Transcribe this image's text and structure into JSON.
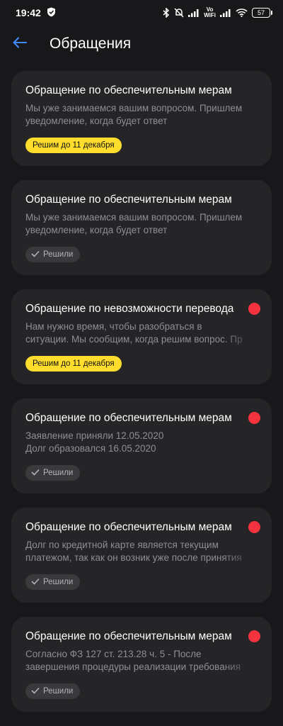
{
  "status_bar": {
    "time": "19:42",
    "vo": "Vo",
    "wifi_label": "WiFi",
    "battery": "57"
  },
  "header": {
    "title": "Обращения",
    "back_icon": "arrow-left-icon",
    "accent_color": "#3f8cff"
  },
  "cards": [
    {
      "title": "Обращение по обеспечительным мерам",
      "lines": [
        "Мы уже занимаемся вашим вопросом. Пришлем",
        "уведомление, когда будет ответ"
      ],
      "badge": "Решим до 11 декабря",
      "unread": false
    },
    {
      "title": "Обращение по обеспечительным мерам",
      "lines": [
        "Мы уже занимаемся вашим вопросом. Пришлем",
        "уведомление, когда будет ответ"
      ],
      "badge": "Решили",
      "unread": false
    },
    {
      "title": "Обращение по невозможности перевода",
      "lines": [
        "Нам нужно время, чтобы разобраться в",
        "ситуации. Мы сообщим, когда решим вопрос. Пр"
      ],
      "badge": "Решим до 11 декабря",
      "unread": true
    },
    {
      "title": "Обращение по обеспечительным мерам",
      "lines": [
        "Заявление приняли 12.05.2020",
        "Долг образовался 16.05.2020"
      ],
      "badge": "Решили",
      "unread": true
    },
    {
      "title": "Обращение по обеспечительным мерам",
      "lines": [
        "Долг по кредитной карте является текущим",
        "платежом, так как он возник уже после принятия"
      ],
      "badge": "Решили",
      "unread": true
    },
    {
      "title": "Обращение по обеспечительным мерам",
      "lines": [
        "Согласно ФЗ 127 ст. 213.28 ч. 5 - После",
        "завершения процедуры реализации требования"
      ],
      "badge": "Решили",
      "unread": true
    }
  ],
  "colors": {
    "badge_pending": "#ffdd2d",
    "badge_done": "#3a3a3c",
    "unread_dot": "#f5333f"
  }
}
